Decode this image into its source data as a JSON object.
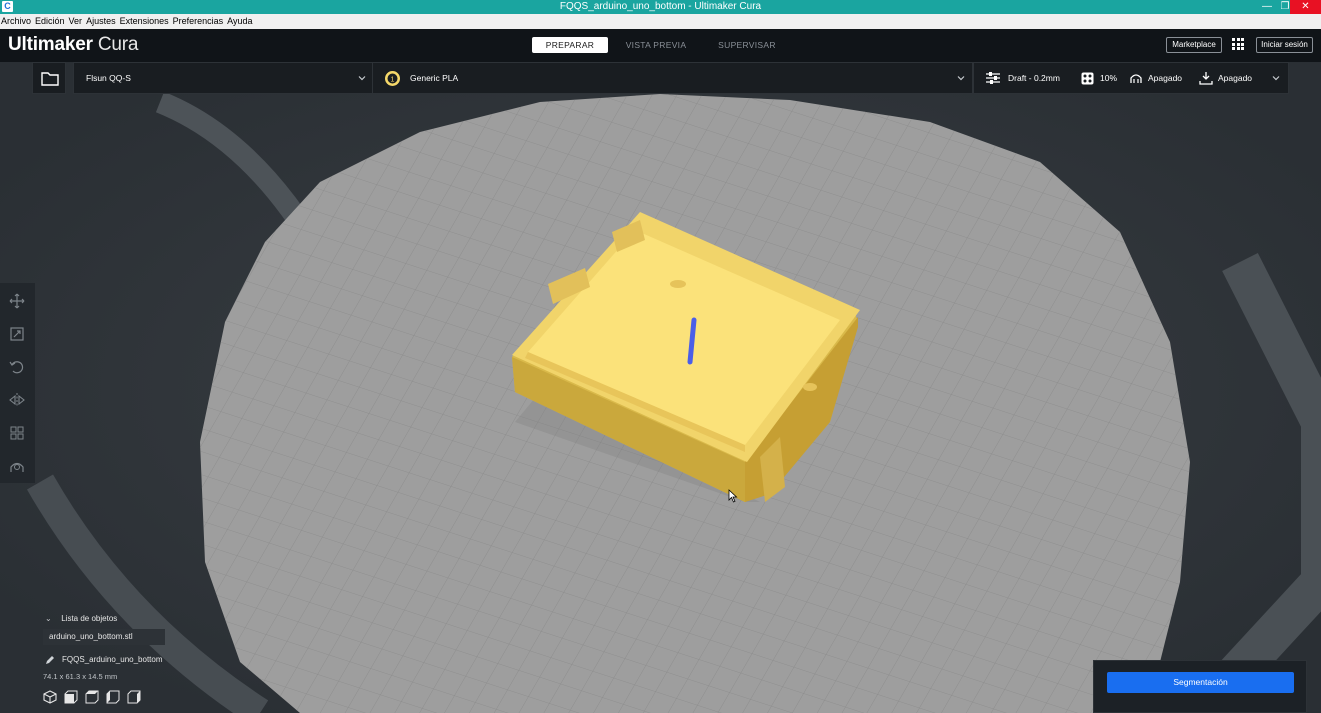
{
  "window": {
    "title": "FQQS_arduino_uno_bottom - Ultimaker Cura",
    "icon_letter": "C",
    "controls": {
      "minimize": "—",
      "maximize": "❐",
      "close": "✕"
    }
  },
  "menu": [
    "Archivo",
    "Edición",
    "Ver",
    "Ajustes",
    "Extensiones",
    "Preferencias",
    "Ayuda"
  ],
  "header": {
    "logo_bold": "Ultimaker",
    "logo_light": " Cura",
    "stages": {
      "prepare": "PREPARAR",
      "preview": "VISTA PREVIA",
      "monitor": "SUPERVISAR"
    },
    "marketplace": "Marketplace",
    "signin": "Iniciar sesión"
  },
  "toolbar": {
    "printer": "Flsun QQ-S",
    "material": "Generic PLA",
    "profile": "Draft - 0.2mm",
    "infill": "10%",
    "support": "Apagado",
    "adhesion": "Apagado"
  },
  "objects": {
    "header": "Lista de objetos",
    "items": [
      "arduino_uno_bottom.stl"
    ],
    "job_name": "FQQS_arduino_uno_bottom",
    "dimensions": "74.1 x 61.3 x 14.5 mm"
  },
  "slice": {
    "button": "Segmentación"
  },
  "colors": {
    "accent": "#196ef0",
    "model": "#f5d86a",
    "titlebar": "#1aa5a0",
    "header": "#101418",
    "buildplate": "#9a9a9a"
  }
}
